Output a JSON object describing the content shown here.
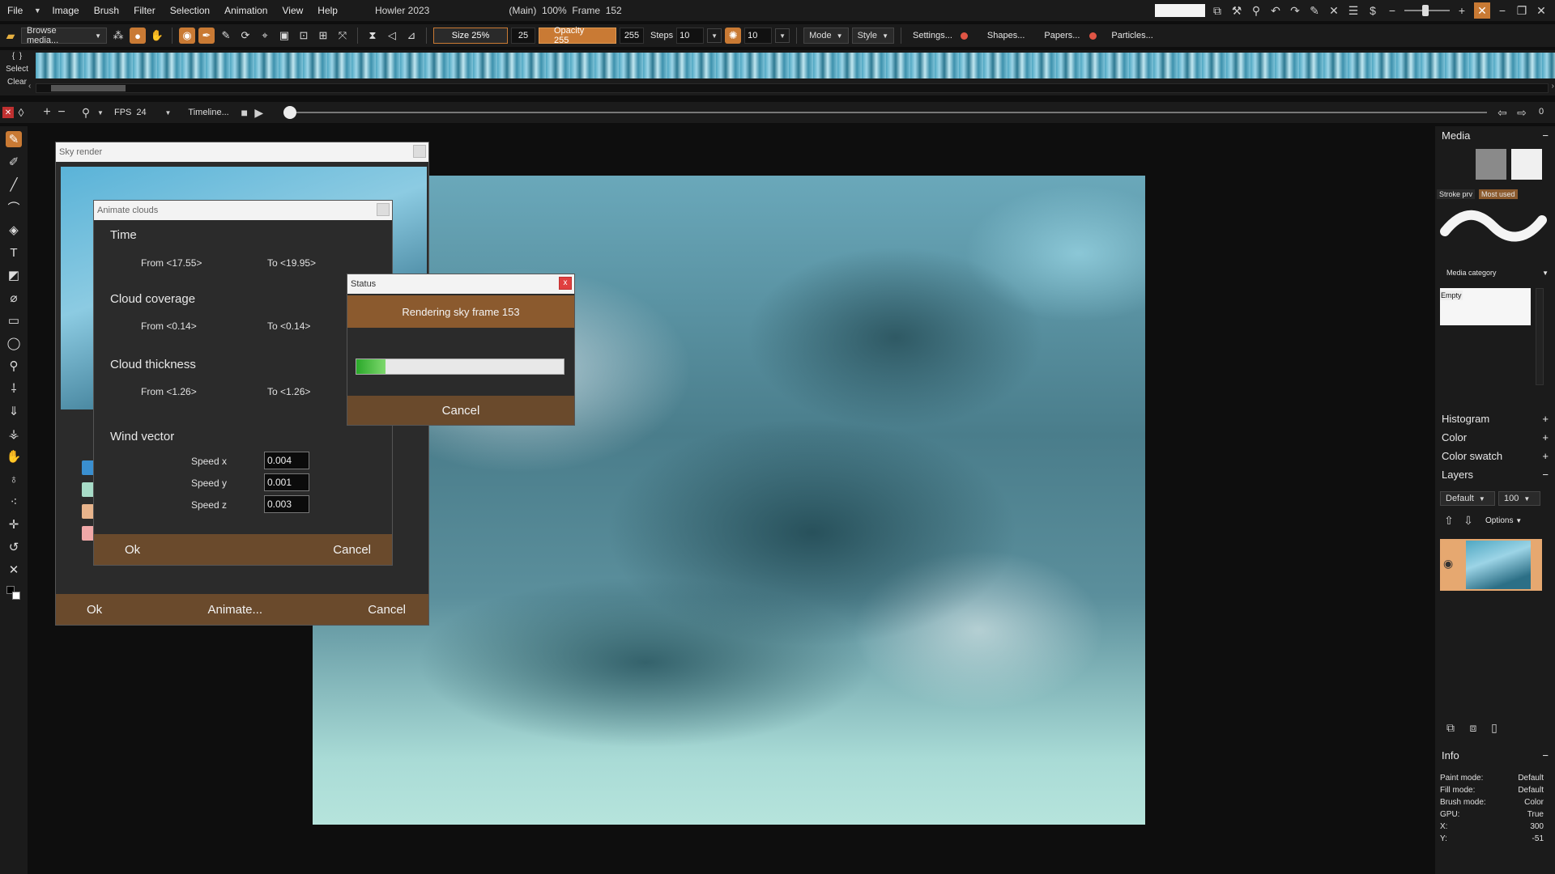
{
  "menu": {
    "items": [
      "File",
      "Image",
      "Brush",
      "Filter",
      "Selection",
      "Animation",
      "View",
      "Help"
    ],
    "app_title": "Howler 2023",
    "status": "(Main)  100%  Frame  152"
  },
  "toolbar": {
    "browse_media": "Browse media...",
    "size_label": "Size 25%",
    "size_value": "25",
    "opacity_label": "Opacity 255",
    "opacity_value": "255",
    "steps_label": "Steps",
    "steps_value": "10",
    "secondary_value": "10",
    "mode": "Mode",
    "style": "Style",
    "settings": "Settings...",
    "shapes": "Shapes...",
    "papers": "Papers...",
    "particles": "Particles..."
  },
  "strip": {
    "select": "Select",
    "clear": "Clear",
    "braces": "{  }"
  },
  "timeline": {
    "fps_label": "FPS",
    "fps_value": "24",
    "timeline_label": "Timeline...",
    "end_value": "0"
  },
  "sky_render": {
    "title": "Sky render",
    "ok": "Ok",
    "animate": "Animate...",
    "cancel": "Cancel"
  },
  "animate_clouds": {
    "title": "Animate clouds",
    "time": {
      "label": "Time",
      "from": "From <17.55>",
      "to": "To <19.95>"
    },
    "coverage": {
      "label": "Cloud coverage",
      "from": "From <0.14>",
      "to": "To <0.14>"
    },
    "thickness": {
      "label": "Cloud thickness",
      "from": "From <1.26>",
      "to": "To <1.26>"
    },
    "wind": {
      "label": "Wind vector",
      "speed_x_label": "Speed x",
      "speed_x": "0.004",
      "speed_y_label": "Speed y",
      "speed_y": "0.001",
      "speed_z_label": "Speed z",
      "speed_z": "0.003"
    },
    "ok": "Ok",
    "cancel": "Cancel"
  },
  "status_dialog": {
    "title": "Status",
    "message": "Rendering sky frame 153",
    "progress": 0.14,
    "cancel": "Cancel",
    "close": "x"
  },
  "right_panel": {
    "media": "Media",
    "stroke_prv": "Stroke prv",
    "most_used": "Most used",
    "media_category": "Media category",
    "empty": "Empty",
    "histogram": "Histogram",
    "color": "Color",
    "color_swatch": "Color swatch",
    "layers": "Layers",
    "layer_blend": "Default",
    "layer_opacity": "100",
    "options": "Options",
    "info": "Info",
    "info_rows": [
      {
        "k": "Paint mode:",
        "v": "Default"
      },
      {
        "k": "Fill mode:",
        "v": "Default"
      },
      {
        "k": "Brush mode:",
        "v": "Color"
      },
      {
        "k": "GPU:",
        "v": "True"
      },
      {
        "k": "X:",
        "v": "300"
      },
      {
        "k": "Y:",
        "v": "-51"
      }
    ]
  },
  "colors": {
    "accent": "#c97a34",
    "dialog_footer": "#6a4a2c",
    "status_bar": "#8b5a2e",
    "swatches": [
      "#3a8fd0",
      "#a8dcc8",
      "#e8b48c",
      "#f0a8a8"
    ]
  }
}
